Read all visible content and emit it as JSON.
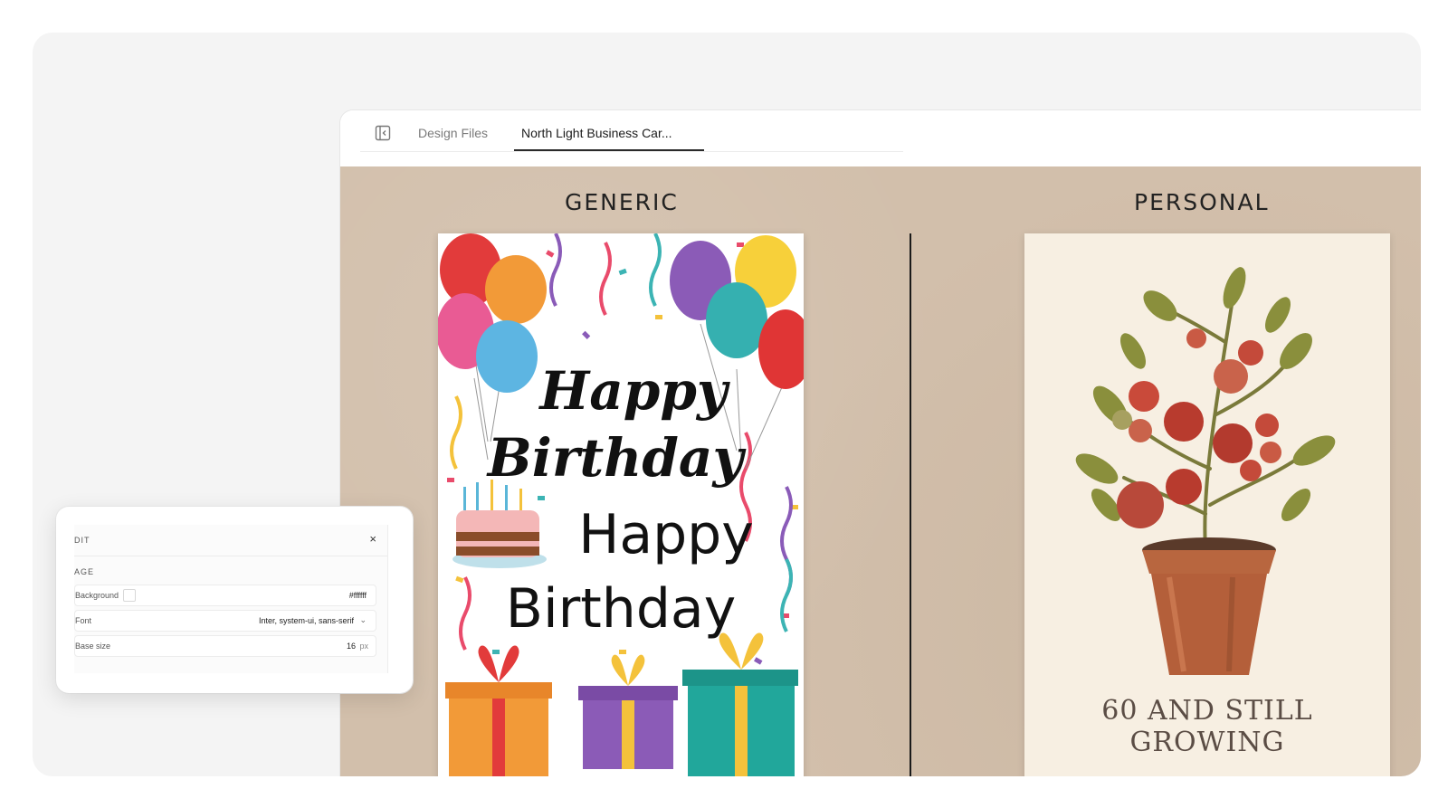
{
  "tabs": {
    "design_files": "Design Files",
    "active": "North Light Business Car..."
  },
  "columns": {
    "generic": "GENERIC",
    "personal": "PERSONAL"
  },
  "generic_card": {
    "script_line1": "Happy",
    "script_line2": "Birthday",
    "plain_line1": "Happy",
    "plain_line2": "Birthday"
  },
  "personal_card": {
    "caption": "60 AND STILL GROWING"
  },
  "editor": {
    "title": "DIT",
    "close": "×",
    "section": "AGE",
    "background_label": "Background",
    "background_value": "#ffffff",
    "font_label": "Font",
    "font_value": "Inter, system-ui, sans-serif",
    "base_size_label": "Base size",
    "base_size_value": "16",
    "base_size_unit": "px"
  },
  "colors": {
    "canvas": "#d2bfab",
    "personal_card_bg": "#f7efe2",
    "caption": "#5b4d45"
  },
  "icons": {
    "panel_toggle": "sidebar-panel-icon",
    "close": "close-icon",
    "chevron": "chevron-down-icon"
  }
}
